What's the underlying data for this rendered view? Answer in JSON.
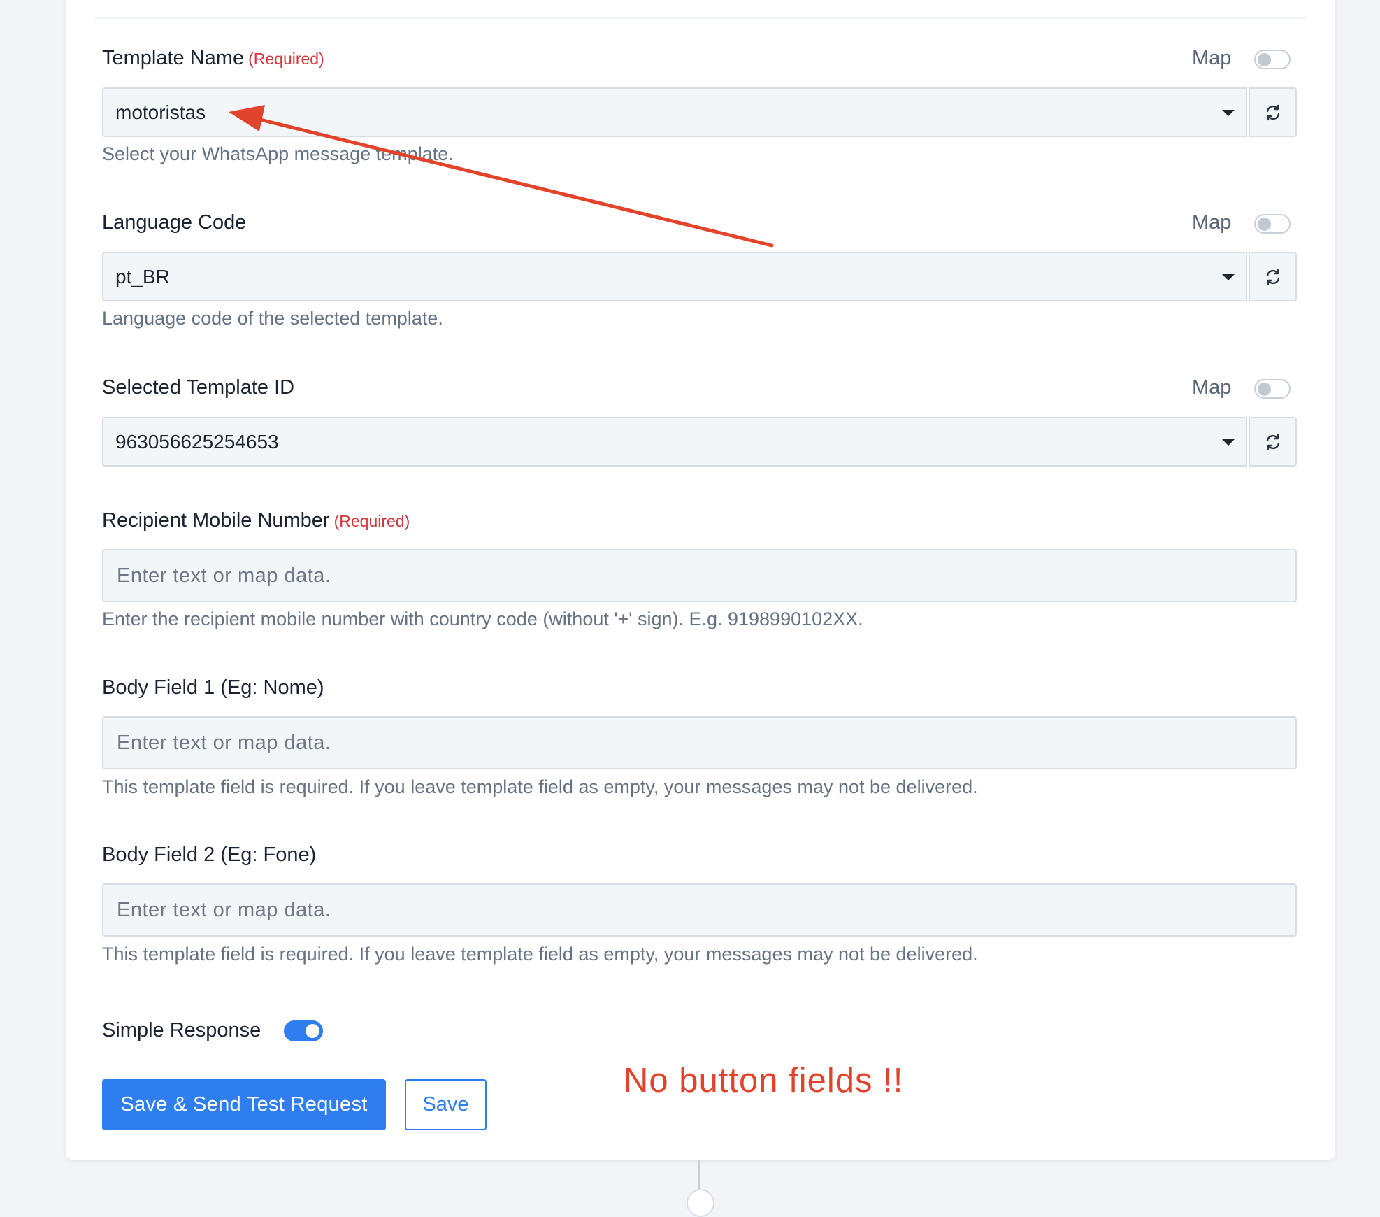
{
  "colors": {
    "accent": "#2f7ef0",
    "required": "#d1363b",
    "annotation": "#e2432b"
  },
  "fields": {
    "template_name": {
      "label": "Template Name",
      "required": "(Required)",
      "map_label": "Map",
      "map_on": false,
      "value": "motoristas",
      "help": "Select your WhatsApp message template."
    },
    "language_code": {
      "label": "Language Code",
      "map_label": "Map",
      "map_on": false,
      "value": "pt_BR",
      "help": "Language code of the selected template."
    },
    "template_id": {
      "label": "Selected Template ID",
      "map_label": "Map",
      "map_on": false,
      "value": "963056625254653"
    },
    "recipient": {
      "label": "Recipient Mobile Number",
      "required": "(Required)",
      "placeholder": "Enter text or map data.",
      "value": "",
      "help": "Enter the recipient mobile number with country code (without '+' sign). E.g. 9198990102XX."
    },
    "body_field_1": {
      "label": "Body Field 1 (Eg: Nome)",
      "placeholder": "Enter text or map data.",
      "value": "",
      "help": "This template field is required. If you leave template field as empty, your messages may not be delivered."
    },
    "body_field_2": {
      "label": "Body Field 2 (Eg: Fone)",
      "placeholder": "Enter text or map data.",
      "value": "",
      "help": "This template field is required. If you leave template field as empty, your messages may not be delivered."
    }
  },
  "simple_response": {
    "label": "Simple Response",
    "on": true
  },
  "buttons": {
    "save_send": "Save & Send Test Request",
    "save": "Save"
  },
  "icons": {
    "dropdown": "caret-down-icon",
    "refresh": "refresh-icon"
  },
  "annotation": {
    "text": "No button fields !!"
  }
}
